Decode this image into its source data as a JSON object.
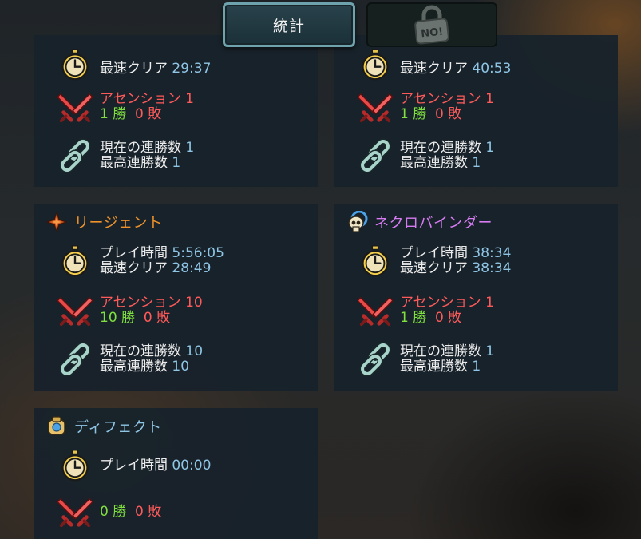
{
  "tabs": {
    "stats_label": "統計",
    "locked_label": "NO!"
  },
  "icons": {
    "timer": "stopwatch-icon",
    "ascension": "crossed-swords-icon",
    "streak": "chain-icon",
    "locked_tab": "padlock-icon"
  },
  "colors": {
    "label": "#ececec",
    "value": "#8fc6e6",
    "ascension": "#ff5a5a",
    "wins": "#7fe03f",
    "losses": "#ff5a5a"
  },
  "panels": [
    {
      "name": "",
      "best_clear_label": "最速クリア",
      "best_clear": "29:37",
      "ascension_label": "アセンション",
      "ascension": "1",
      "wins": "1",
      "win_label": "勝",
      "losses": "0",
      "loss_label": "敗",
      "streak_label": "現在の連勝数",
      "streak": "1",
      "best_streak_label": "最高連勝数",
      "best_streak": "1"
    },
    {
      "name": "",
      "best_clear_label": "最速クリア",
      "best_clear": "40:53",
      "ascension_label": "アセンション",
      "ascension": "1",
      "wins": "1",
      "win_label": "勝",
      "losses": "0",
      "loss_label": "敗",
      "streak_label": "現在の連勝数",
      "streak": "1",
      "best_streak_label": "最高連勝数",
      "best_streak": "1"
    },
    {
      "name": "リージェント",
      "name_color": "#f0922b",
      "icon": "regent-star-icon",
      "playtime_label": "プレイ時間",
      "playtime": "5:56:05",
      "best_clear_label": "最速クリア",
      "best_clear": "28:49",
      "ascension_label": "アセンション",
      "ascension": "10",
      "wins": "10",
      "win_label": "勝",
      "losses": "0",
      "loss_label": "敗",
      "streak_label": "現在の連勝数",
      "streak": "10",
      "best_streak_label": "最高連勝数",
      "best_streak": "10"
    },
    {
      "name": "ネクロバインダー",
      "name_color": "#d77bf2",
      "icon": "skull-icon",
      "playtime_label": "プレイ時間",
      "playtime": "38:34",
      "best_clear_label": "最速クリア",
      "best_clear": "38:34",
      "ascension_label": "アセンション",
      "ascension": "1",
      "wins": "1",
      "win_label": "勝",
      "losses": "0",
      "loss_label": "敗",
      "streak_label": "現在の連勝数",
      "streak": "1",
      "best_streak_label": "最高連勝数",
      "best_streak": "1"
    },
    {
      "name": "ディフェクト",
      "name_color": "#8fc6e6",
      "icon": "defect-orb-icon",
      "playtime_label": "プレイ時間",
      "playtime": "00:00",
      "wins": "0",
      "win_label": "勝",
      "losses": "0",
      "loss_label": "敗"
    }
  ]
}
